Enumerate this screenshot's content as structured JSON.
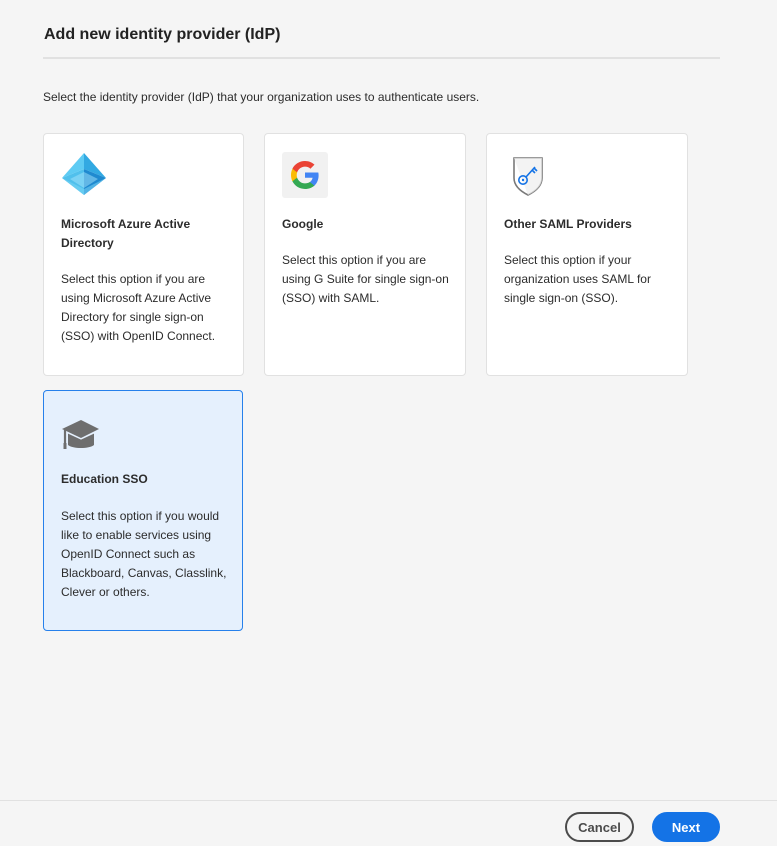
{
  "dialog": {
    "title": "Add new identity provider (IdP)",
    "intro": "Select the identity provider (IdP) that your organization uses to authenticate users."
  },
  "providers": [
    {
      "title": "Microsoft Azure Active Directory",
      "description": "Select this option if you are using Microsoft Azure Active Directory for single sign-on (SSO) with OpenID Connect.",
      "icon": "azure-pyramid-icon",
      "selected": false
    },
    {
      "title": "Google",
      "description": "Select this option if you are using G Suite for single sign-on (SSO) with SAML.",
      "icon": "google-g-icon",
      "selected": false
    },
    {
      "title": "Other SAML Providers",
      "description": "Select this option if your organization uses SAML for single sign-on (SSO).",
      "icon": "shield-key-icon",
      "selected": false
    },
    {
      "title": "Education SSO",
      "description": "Select this option if you would like to enable services using OpenID Connect such as Blackboard, Canvas, Classlink, Clever or others.",
      "icon": "graduation-cap-icon",
      "selected": true
    }
  ],
  "footer": {
    "cancel_label": "Cancel",
    "next_label": "Next"
  },
  "colors": {
    "accent": "#1473e6",
    "selected_border": "#2680eb",
    "selected_bg": "#e5f0fd"
  }
}
